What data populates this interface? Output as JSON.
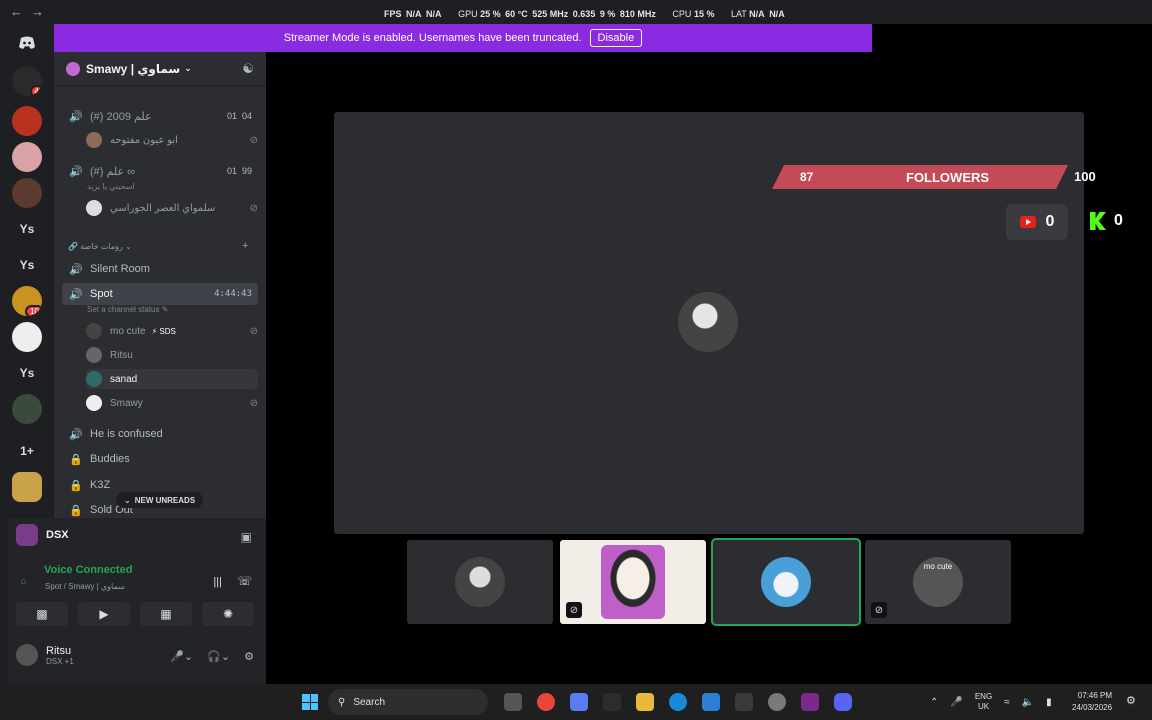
{
  "overlay": {
    "fps_label": "FPS",
    "fps1": "N/A",
    "fps2": "N/A",
    "gpu_label": "GPU",
    "gpu_load": "25 %",
    "gpu_temp": "60 °C",
    "gpu_clock": "525 MHz",
    "gpu_mem": "0.635",
    "gpu_mem2": "9 %",
    "gpu_mem_clock": "810 MHz",
    "cpu_label": "CPU",
    "cpu_load": "15 %",
    "lat_label": "LAT",
    "lat1": "N/A",
    "lat2": "N/A"
  },
  "banner": {
    "text": "Streamer Mode is enabled. Usernames have been truncated.",
    "button": "Disable"
  },
  "rail": {
    "servers": [
      {
        "icon": "discord-logo-icon"
      },
      {
        "badge": "4"
      },
      {},
      {},
      {},
      {
        "label": "Ys"
      },
      {
        "label": "Ys"
      },
      {
        "badge": "10"
      },
      {},
      {
        "label": "Ys"
      },
      {},
      {
        "label": "1+"
      },
      {}
    ]
  },
  "server": {
    "name": "Smawy | سماوي"
  },
  "channels": [
    {
      "name": "(#) 2009 علم",
      "r1": "01",
      "r2": "04"
    },
    {
      "name": "(#) علم ∞",
      "r1": "01",
      "r2": "99"
    },
    {
      "name": "Silent Room"
    },
    {
      "name": "Spot",
      "time": "4:44:43",
      "status": "Set a channel status"
    },
    {
      "name": "He is confused"
    },
    {
      "name": "Buddies"
    },
    {
      "name": "K3Z"
    },
    {
      "name": "Sold Out"
    }
  ],
  "channel_users": {
    "ch1_user": "ابو عيون مفتوحه",
    "ch2_sub": "اسحبني يا يزيد",
    "ch2_user": "سلمواي العصر الجوراسي",
    "category": "رومات خاصة",
    "spot_users": [
      "mo cute",
      "Ritsu",
      "sanad",
      "Smawy"
    ],
    "sds_tag": "⚡ SDS"
  },
  "new_unreads": "NEW UNREADS",
  "activity": {
    "name": "DSX"
  },
  "voice": {
    "status": "Voice Connected",
    "channel": "Spot / Smawy | سماوي"
  },
  "user": {
    "name": "Ritsu",
    "sub": "DSX +1"
  },
  "stream": {
    "followers_current": "87",
    "followers_label": "FOLLOWERS",
    "followers_goal": "100",
    "youtube_count": "0",
    "kick_count": "0",
    "progress_fraction": 0.87
  },
  "tiles": [
    {
      "label": ""
    },
    {
      "label": ""
    },
    {
      "label": ""
    },
    {
      "label": "mo cute"
    }
  ],
  "taskbar": {
    "search": "Search",
    "lang1": "ENG",
    "lang2": "UK",
    "time": "07:46 PM",
    "date": "24/03/2026"
  },
  "colors": {
    "accent": "#8a2be2",
    "green": "#23a55a",
    "red_bar": "#c44a58"
  }
}
